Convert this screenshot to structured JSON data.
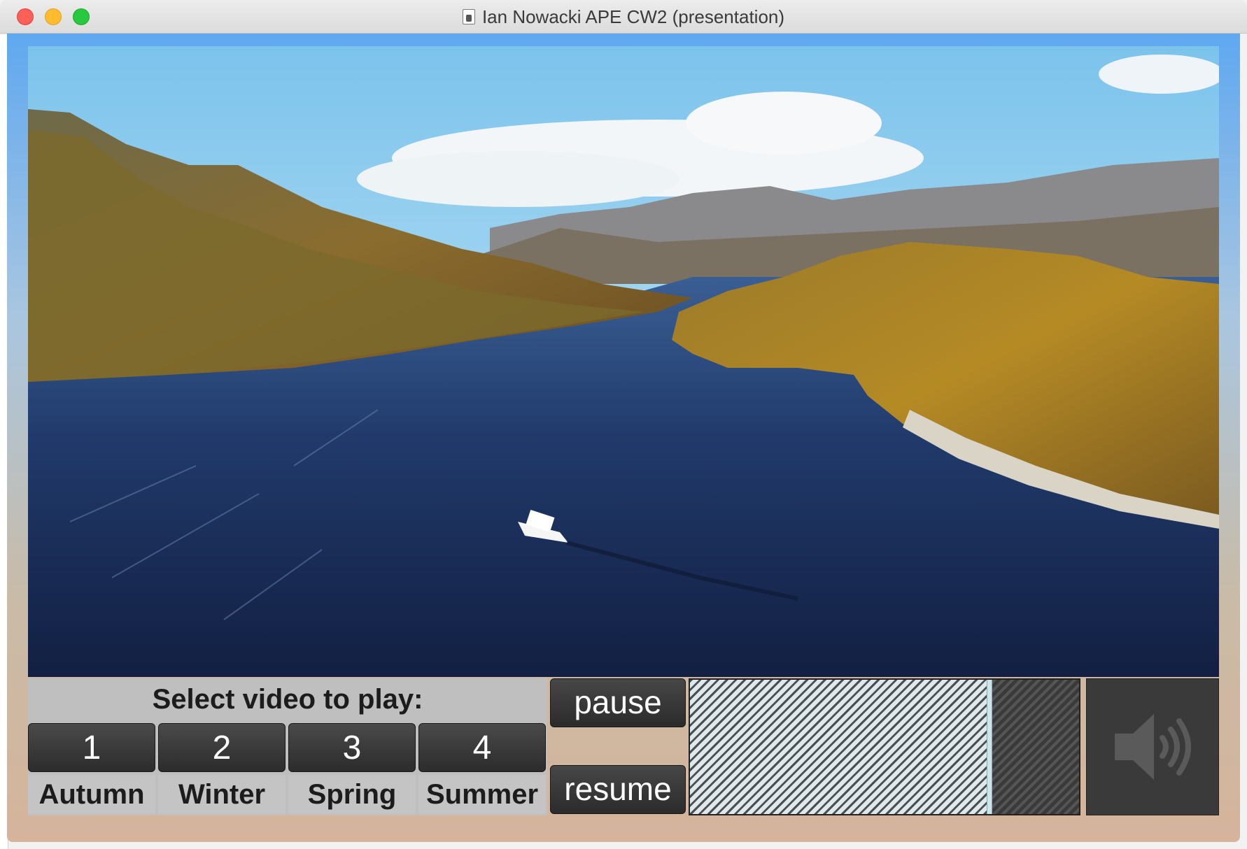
{
  "window": {
    "title": "Ian Nowacki APE CW2 (presentation)"
  },
  "video": {
    "description_icon": "video-frame"
  },
  "selector": {
    "label": "Select video to play:",
    "buttons": [
      {
        "number": "1",
        "season": "Autumn"
      },
      {
        "number": "2",
        "season": "Winter"
      },
      {
        "number": "3",
        "season": "Spring"
      },
      {
        "number": "4",
        "season": "Summer"
      }
    ]
  },
  "playback": {
    "pause_label": "pause",
    "resume_label": "resume",
    "progress_fraction": 0.77
  },
  "volume": {
    "icon": "speaker-volume-icon"
  },
  "colors": {
    "button_dark": "#2c2c2c",
    "panel_gray": "#bfbfbf"
  }
}
